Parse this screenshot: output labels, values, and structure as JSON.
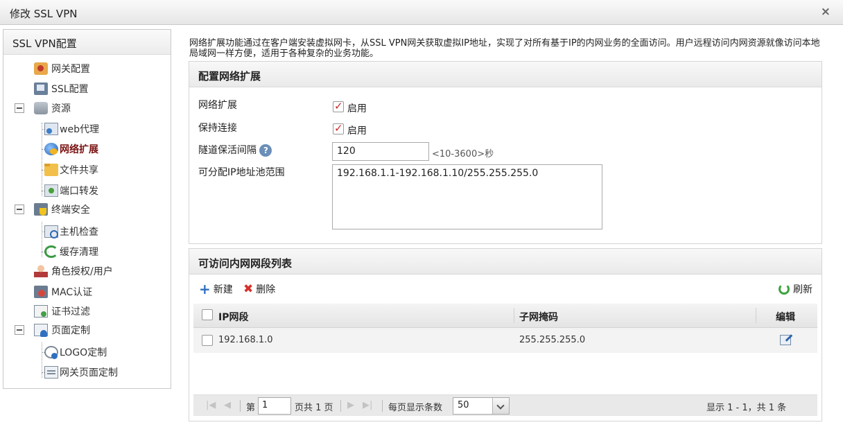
{
  "dialog": {
    "title": "修改 SSL VPN",
    "close_label": "×"
  },
  "sidebar": {
    "title": "SSL VPN配置",
    "items": [
      {
        "label": "网关配置",
        "icon": "gateway-config-icon"
      },
      {
        "label": "SSL配置",
        "icon": "ssl-config-icon"
      },
      {
        "label": "资源",
        "icon": "resource-icon"
      },
      {
        "label": "web代理",
        "icon": "web-proxy-icon"
      },
      {
        "label": "网络扩展",
        "icon": "network-extension-icon"
      },
      {
        "label": "文件共享",
        "icon": "file-share-icon"
      },
      {
        "label": "端口转发",
        "icon": "port-forward-icon"
      },
      {
        "label": "终端安全",
        "icon": "terminal-security-icon"
      },
      {
        "label": "主机检查",
        "icon": "host-check-icon"
      },
      {
        "label": "缓存清理",
        "icon": "cache-clean-icon"
      },
      {
        "label": "角色授权/用户",
        "icon": "role-auth-icon"
      },
      {
        "label": "MAC认证",
        "icon": "mac-auth-icon"
      },
      {
        "label": "证书过滤",
        "icon": "cert-filter-icon"
      },
      {
        "label": "页面定制",
        "icon": "page-custom-icon"
      },
      {
        "label": "LOGO定制",
        "icon": "logo-custom-icon"
      },
      {
        "label": "网关页面定制",
        "icon": "gateway-page-icon"
      }
    ]
  },
  "description": "网络扩展功能通过在客户端安装虚拟网卡，从SSL VPN网关获取虚拟IP地址，实现了对所有基于IP的内网业务的全面访问。用户远程访问内网资源就像访问本地局域网一样方便，适用于各种复杂的业务功能。",
  "config_panel": {
    "title": "配置网络扩展",
    "network_extension_label": "网络扩展",
    "network_extension_enabled": "启用",
    "keepalive_label": "保持连接",
    "keepalive_enabled": "启用",
    "tunnel_interval_label": "隧道保活间隔",
    "tunnel_interval_value": "120",
    "tunnel_interval_hint": "<10-3600>秒",
    "ip_pool_label": "可分配IP地址池范围",
    "ip_pool_value": "192.168.1.1-192.168.1.10/255.255.255.0"
  },
  "segment_panel": {
    "title": "可访问内网网段列表",
    "new_label": "新建",
    "delete_label": "删除",
    "refresh_label": "刷新",
    "columns": [
      "IP网段",
      "子网掩码",
      "编辑"
    ],
    "rows": [
      {
        "ip": "192.168.1.0",
        "mask": "255.255.255.0"
      }
    ]
  },
  "pager": {
    "page_prefix": "第",
    "page_value": "1",
    "page_suffix": "页共 1 页",
    "per_page_label": "每页显示条数",
    "per_page_value": "50",
    "summary": "显示 1 - 1，共 1 条"
  }
}
